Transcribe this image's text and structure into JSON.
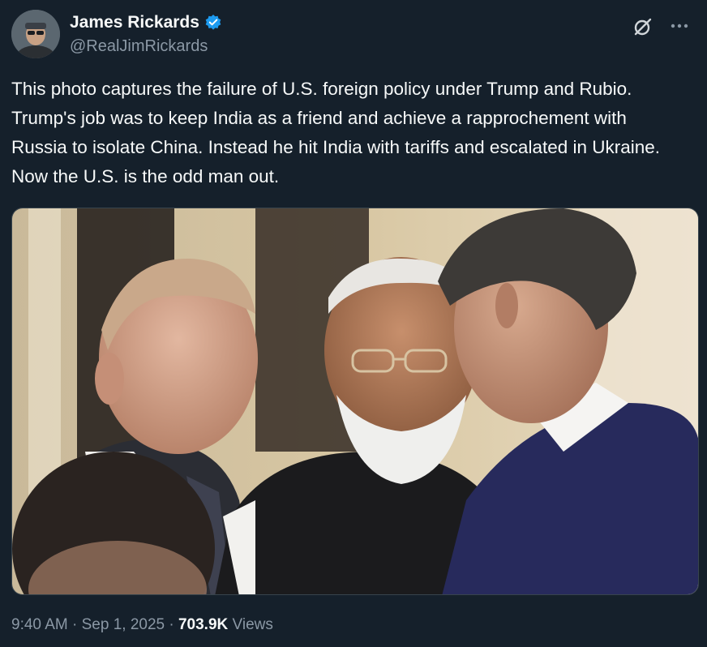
{
  "author": {
    "name": "James Rickards",
    "handle": "@RealJimRickards",
    "verified": true,
    "verified_color": "#1d9bf0"
  },
  "post": {
    "text": "This photo captures the failure of U.S. foreign policy under Trump and Rubio. Trump's job was to keep India as a friend and achieve a rapprochement with Russia to isolate China. Instead he hit India with tariffs and escalated in Ukraine. Now the U.S. is the odd man out.",
    "image_subject": "photo-three-leaders"
  },
  "meta": {
    "time": "9:40 AM",
    "separator": "·",
    "date": "Sep 1, 2025",
    "views_count": "703.9K",
    "views_label": "Views"
  },
  "icons": {
    "grok": "grok-icon",
    "more": "more-icon",
    "verified": "verified-badge-icon"
  },
  "colors": {
    "background": "#15202b",
    "text": "#f7f9f9",
    "secondary": "#8b98a5"
  }
}
